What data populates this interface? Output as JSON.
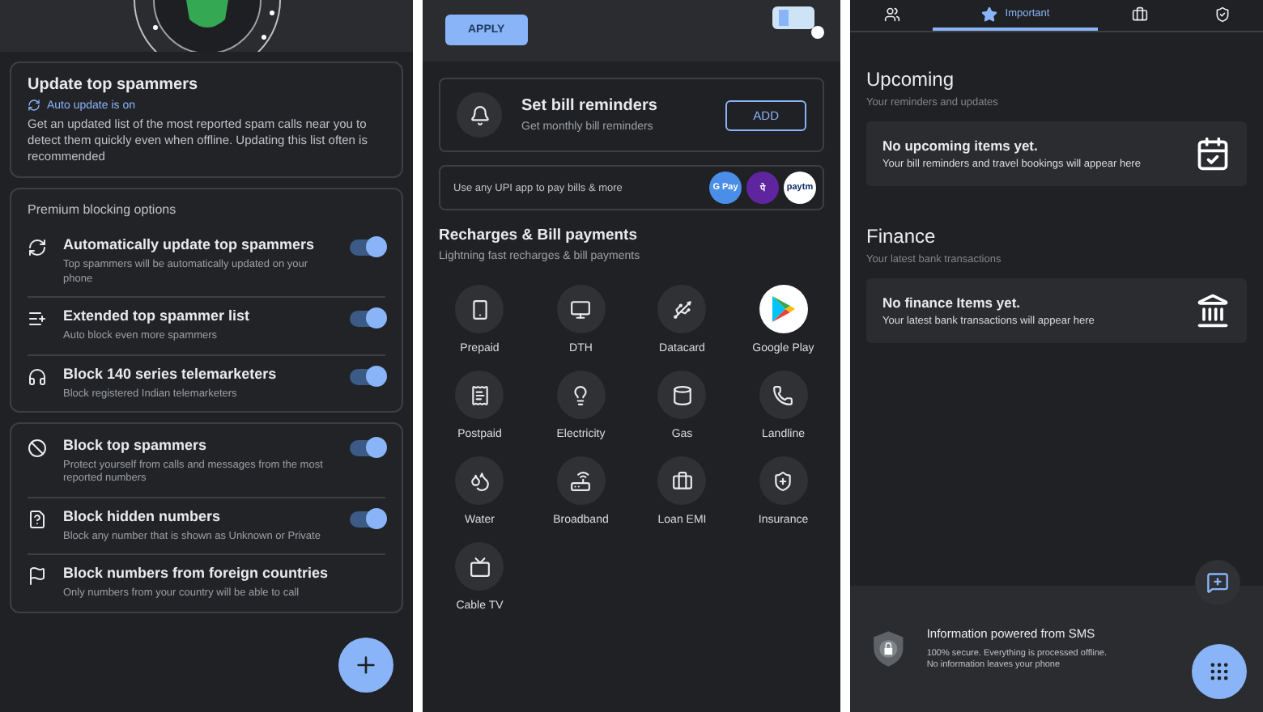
{
  "spam_panel": {
    "update_card": {
      "title": "Update top spammers",
      "status": "Auto update is on",
      "description": "Get an updated list of the most reported spam calls near you to detect them quickly even when offline. Updating this list often is recommended"
    },
    "premium_card": {
      "heading": "Premium blocking options",
      "options": [
        {
          "kind": "refresh",
          "title": "Automatically update top spammers",
          "subtitle": "Top spammers will be automatically updated on your phone",
          "on": true
        },
        {
          "kind": "list",
          "title": "Extended top spammer list",
          "subtitle": "Auto block even more spammers",
          "on": true
        },
        {
          "kind": "headset",
          "title": "Block 140 series telemarketers",
          "subtitle": "Block registered Indian telemarketers",
          "on": true
        }
      ]
    },
    "blocking_card": {
      "options": [
        {
          "kind": "ban",
          "title": "Block top spammers",
          "subtitle": "Protect yourself from calls and messages from the most reported numbers",
          "on": true
        },
        {
          "kind": "hidden",
          "title": "Block hidden numbers",
          "subtitle": "Block any number that is shown as Unknown or Private",
          "on": true
        },
        {
          "kind": "flag",
          "title": "Block numbers from foreign countries",
          "subtitle": "Only numbers from your country will be able to call"
        }
      ]
    }
  },
  "bills_panel": {
    "apply_button": "APPLY",
    "reminder_card": {
      "title": "Set bill reminders",
      "subtitle": "Get monthly bill reminders",
      "button": "ADD"
    },
    "upi_banner": {
      "text": "Use any UPI app to pay bills & more",
      "apps": [
        {
          "label": "G Pay",
          "color": "#4a8ee8"
        },
        {
          "label": "पे",
          "color": "#5f259f"
        },
        {
          "label": "paytm",
          "color": "#ffffff"
        }
      ]
    },
    "section": {
      "title": "Recharges & Bill payments",
      "subtitle": "Lightning fast recharges & bill payments"
    },
    "services": [
      {
        "kind": "phone",
        "label": "Prepaid"
      },
      {
        "kind": "monitor",
        "label": "DTH"
      },
      {
        "kind": "usb",
        "label": "Datacard"
      },
      {
        "kind": "play",
        "label": "Google Play"
      },
      {
        "kind": "receipt",
        "label": "Postpaid"
      },
      {
        "kind": "bulb",
        "label": "Electricity"
      },
      {
        "kind": "cylinder",
        "label": "Gas"
      },
      {
        "kind": "landline",
        "label": "Landline"
      },
      {
        "kind": "tap",
        "label": "Water"
      },
      {
        "kind": "router",
        "label": "Broadband"
      },
      {
        "kind": "case",
        "label": "Loan EMI"
      },
      {
        "kind": "insurance",
        "label": "Insurance"
      },
      {
        "kind": "tv",
        "label": "Cable TV"
      }
    ]
  },
  "important_panel": {
    "tabs": [
      {
        "kind": "people",
        "selected": false
      },
      {
        "kind": "star",
        "label": "Important",
        "selected": true
      },
      {
        "kind": "briefcase",
        "selected": false
      },
      {
        "kind": "shield",
        "selected": false
      }
    ],
    "sections": [
      {
        "kind": "calendar",
        "title": "Upcoming",
        "subtitle": "Your reminders and updates",
        "card_title": "No upcoming items yet.",
        "card_text": "Your bill reminders and travel bookings will appear here"
      },
      {
        "kind": "bank",
        "title": "Finance",
        "subtitle": "Your latest bank transactions",
        "card_title": "No finance Items yet.",
        "card_text": "Your latest bank transactions will appear here"
      }
    ],
    "footer": {
      "title": "Information powered from SMS",
      "text": "100% secure. Everything is processed offline. No information leaves your phone"
    }
  }
}
